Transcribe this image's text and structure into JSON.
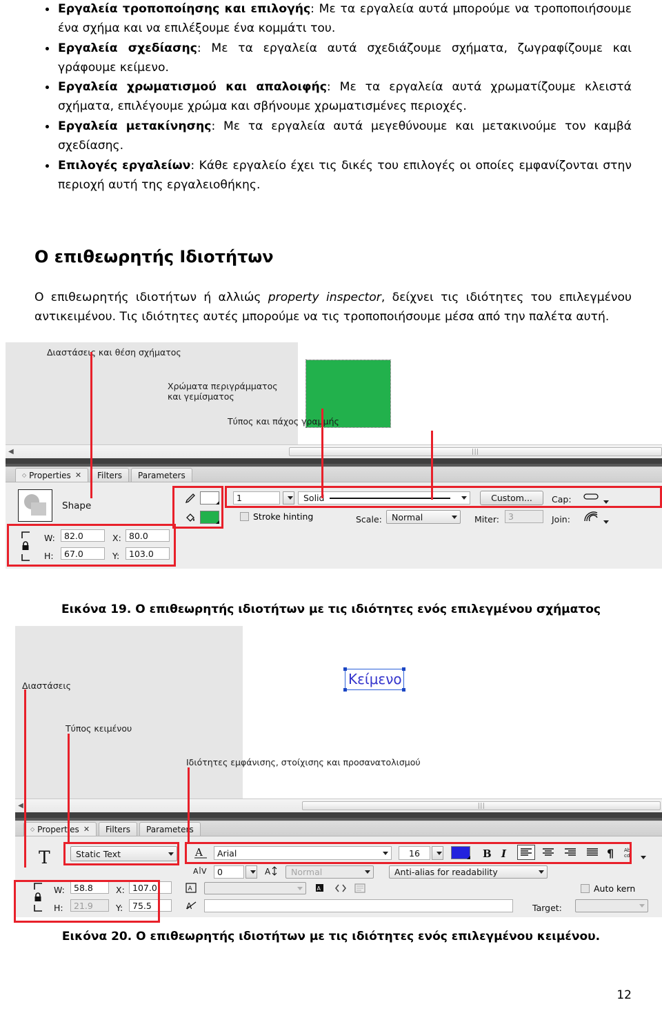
{
  "document": {
    "bullets": [
      {
        "bold": "Εργαλεία τροποποίησης και επιλογής",
        "rest": ": Με τα εργαλεία αυτά μπορούμε να τροποποιήσουμε ένα σχήμα και να επιλέξουμε ένα κομμάτι του."
      },
      {
        "bold": "Εργαλεία σχεδίασης",
        "rest": ": Με τα εργαλεία αυτά σχεδιάζουμε σχήματα, ζωγραφίζουμε και γράφουμε κείμενο."
      },
      {
        "bold": "Εργαλεία χρωματισμού και απαλοιφής",
        "rest": ": Με τα εργαλεία αυτά χρωματίζουμε κλειστά σχήματα, επιλέγουμε χρώμα και σβήνουμε χρωματισμένες περιοχές."
      },
      {
        "bold": "Εργαλεία μετακίνησης",
        "rest": ": Με τα εργαλεία αυτά μεγεθύνουμε και μετακινούμε τον καμβά σχεδίασης."
      },
      {
        "bold": "Επιλογές εργαλείων",
        "rest": ": Κάθε εργαλείο έχει τις δικές του επιλογές οι οποίες εμφανίζονται στην περιοχή αυτή της εργαλειοθήκης."
      }
    ],
    "section_title": "Ο επιθεωρητής Ιδιοτήτων",
    "paragraph_1": "Ο επιθεωρητής ιδιοτήτων ή αλλιώς ",
    "paragraph_italic": "property inspector",
    "paragraph_2": ", δείχνει τις ιδιότητες του επιλεγμένου αντικειμένου. Τις ιδιότητες αυτές μπορούμε να τις τροποποιήσουμε μέσα από την παλέτα αυτή.",
    "page_number": "12"
  },
  "figure19": {
    "caption": "Εικόνα 19. Ο επιθεωρητής ιδιοτήτων με τις ιδιότητες ενός επιλεγμένου σχήματος",
    "annotations": [
      "Διαστάσεις και θέση σχήματος",
      "Χρώματα περιγράμματος\nκαι γεμίσματος",
      "Τύπος και πάχος γραμμής"
    ],
    "tabs": [
      {
        "label": "Properties",
        "active": true,
        "closable": true
      },
      {
        "label": "Filters",
        "active": false,
        "closable": false
      },
      {
        "label": "Parameters",
        "active": false,
        "closable": false
      }
    ],
    "object_type": "Shape",
    "dimensions": {
      "w_label": "W:",
      "w_value": "82.0",
      "h_label": "H:",
      "h_value": "67.0",
      "x_label": "X:",
      "x_value": "80.0",
      "y_label": "Y:",
      "y_value": "103.0"
    },
    "stroke_color": "#ffffff",
    "fill_color": "#22b14c",
    "stroke_width": "1",
    "stroke_style": "Solid",
    "stroke_hinting_label": "Stroke hinting",
    "custom_button": "Custom...",
    "cap_label": "Cap:",
    "join_label": "Join:",
    "scale_label": "Scale:",
    "scale_value": "Normal",
    "miter_label": "Miter:",
    "miter_value": "3",
    "shape_on_stage_color": "#22b14c"
  },
  "figure20": {
    "caption": "Εικόνα 20. Ο επιθεωρητής ιδιοτήτων με τις ιδιότητες ενός επιλεγμένου κειμένου.",
    "annotations": [
      "Διαστάσεις",
      "Τύπος κειμένου",
      "Ιδιότητες εμφάνισης, στοίχισης και προσανατολισμού"
    ],
    "stage_text": "Κείμενο",
    "stage_text_color": "#3333cc",
    "tabs": [
      {
        "label": "Properties",
        "active": true,
        "closable": true
      },
      {
        "label": "Filters",
        "active": false,
        "closable": false
      },
      {
        "label": "Parameters",
        "active": false,
        "closable": false
      }
    ],
    "text_type": "Static Text",
    "font_family_value": "Arial",
    "font_size_value": "16",
    "font_color": "#2222dd",
    "letter_spacing_value": "0",
    "font_style_value": "Normal",
    "antialias_value": "Anti-alias for readability",
    "bold_label": "B",
    "italic_label": "I",
    "auto_kern_label": "Auto kern",
    "target_label": "Target:",
    "dimensions": {
      "w_label": "W:",
      "w_value": "58.8",
      "h_label": "H:",
      "h_value": "21.9",
      "x_label": "X:",
      "x_value": "107.0",
      "y_label": "Y:",
      "y_value": "75.5"
    }
  }
}
